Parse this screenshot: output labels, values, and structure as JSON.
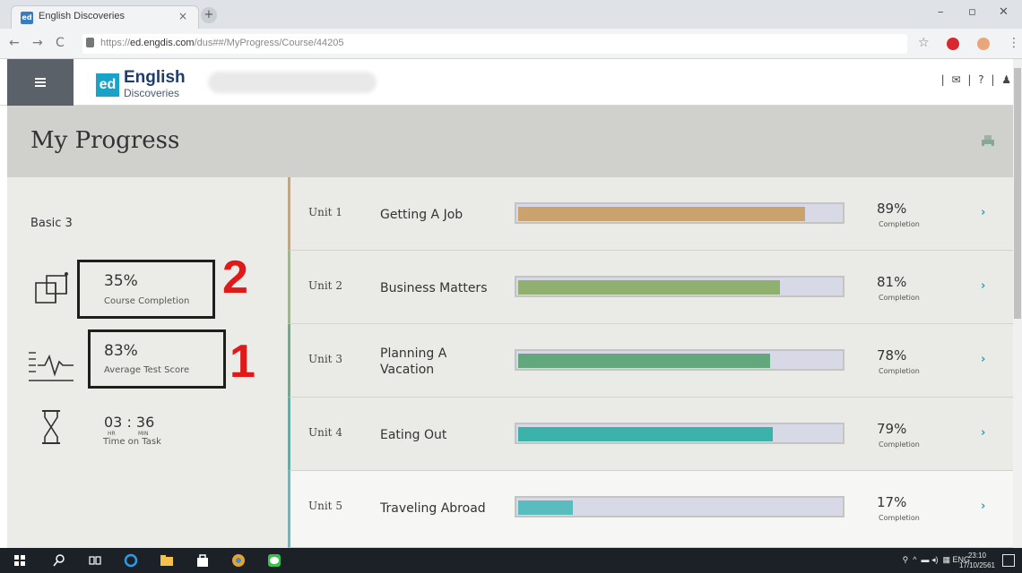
{
  "browser": {
    "tab_title": "English Discoveries",
    "url_prefix": "https://",
    "url_host": "ed.engdis.com",
    "url_path": "/dus##/MyProgress/Course/44205"
  },
  "app": {
    "logo_mark": "ed",
    "logo_title": "English",
    "logo_subtitle": "Discoveries",
    "header_icons": "| ✉ | ? | ♟"
  },
  "page": {
    "title": "My Progress"
  },
  "summary": {
    "course_name": "Basic 3",
    "course_completion_value": "35%",
    "course_completion_label": "Course Completion",
    "average_test_score_value": "83%",
    "average_test_score_label": "Average Test Score",
    "time_on_task_value": "03 : 36",
    "time_unit_hours": "HR",
    "time_unit_minutes": "MIN",
    "time_on_task_label": "Time on Task",
    "annotation_completion": "2",
    "annotation_score": "1"
  },
  "units": [
    {
      "number": "Unit 1",
      "name": "Getting A Job",
      "percent": "89%",
      "completion": 89,
      "label": "Completion",
      "color": "#c9a26d",
      "border": "#cfa46a"
    },
    {
      "number": "Unit 2",
      "name": "Business Matters",
      "percent": "81%",
      "completion": 81,
      "label": "Completion",
      "color": "#8fb06e",
      "border": "#9cbb7e"
    },
    {
      "number": "Unit 3",
      "name": "Planning A Vacation",
      "percent": "78%",
      "completion": 78,
      "label": "Completion",
      "color": "#63a77c",
      "border": "#6aae86"
    },
    {
      "number": "Unit 4",
      "name": "Eating Out",
      "percent": "79%",
      "completion": 79,
      "label": "Completion",
      "color": "#3cb3aa",
      "border": "#45b8b0"
    },
    {
      "number": "Unit 5",
      "name": "Traveling Abroad",
      "percent": "17%",
      "completion": 17,
      "label": "Completion",
      "color": "#5bbcc0",
      "border": "#5dbfc4"
    }
  ],
  "taskbar": {
    "tray_text": "ENG",
    "clock_time": "23:10",
    "clock_date": "17/10/2561"
  }
}
